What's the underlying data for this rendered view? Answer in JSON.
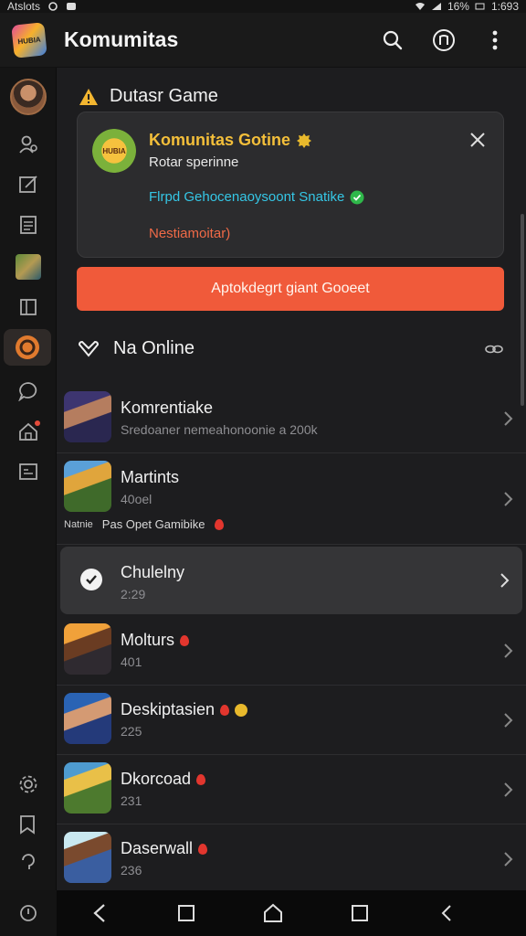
{
  "status_bar": {
    "carrier": "Atslots",
    "right_text": "16%",
    "time": "1:693"
  },
  "header": {
    "logo_text": "HUBIA",
    "title": "Komumitas"
  },
  "section": {
    "title": "Dutasr Game"
  },
  "notice": {
    "icon_text": "HUBIA",
    "title": "Komunitas Gotine",
    "subtitle": "Rotar sperinne",
    "link": "Flrpd Gehocenaoysoont Snatike",
    "note": "Nestiamoitar)"
  },
  "cta": {
    "label": "Aptokdegrt giant Gooeet"
  },
  "online": {
    "title": "Na Online"
  },
  "list": [
    {
      "title": "Komrentiake",
      "subtitle": "Sredoaner nemeahonoonie a 200k"
    },
    {
      "title": "Martints",
      "subtitle": "40oel",
      "extra_tag": "Natnie",
      "extra": "Pas Opet Gamibike"
    },
    {
      "title": "Chulelny",
      "subtitle": "2:29"
    },
    {
      "title": "Molturs",
      "subtitle": "401"
    },
    {
      "title": "Deskiptasien",
      "subtitle": "225"
    },
    {
      "title": "Dkorcoad",
      "subtitle": "231"
    },
    {
      "title": "Daserwall",
      "subtitle": "236"
    }
  ],
  "colors": {
    "accent": "#f05a3a",
    "gold": "#f4bf3a",
    "link": "#35c7e6",
    "note": "#f06a47",
    "background": "#1d1d1f"
  }
}
